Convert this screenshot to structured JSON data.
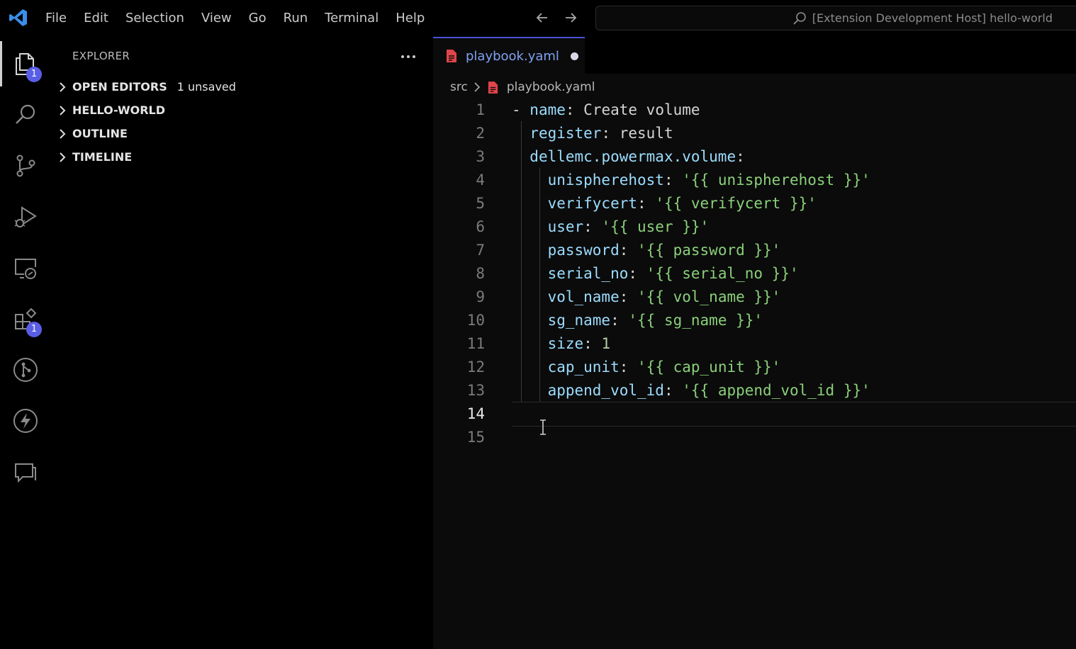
{
  "menu": [
    "File",
    "Edit",
    "Selection",
    "View",
    "Go",
    "Run",
    "Terminal",
    "Help"
  ],
  "command_center": "[Extension Development Host] hello-world",
  "activity_bar": {
    "explorer_badge": "1",
    "extensions_badge": "1"
  },
  "sidebar": {
    "title": "EXPLORER",
    "sections": [
      {
        "label": "OPEN EDITORS",
        "extra": "1 unsaved"
      },
      {
        "label": "HELLO-WORLD",
        "extra": ""
      },
      {
        "label": "OUTLINE",
        "extra": ""
      },
      {
        "label": "TIMELINE",
        "extra": ""
      }
    ]
  },
  "editor": {
    "tab": "playbook.yaml",
    "breadcrumb": {
      "folder": "src",
      "file": "playbook.yaml"
    },
    "lines": [
      {
        "n": "1",
        "indent": "",
        "dash": "- ",
        "key": "name",
        "sep": ": ",
        "val": "Create volume",
        "vtype": "p"
      },
      {
        "n": "2",
        "indent": "  ",
        "dash": "",
        "key": "register",
        "sep": ": ",
        "val": "result",
        "vtype": "p"
      },
      {
        "n": "3",
        "indent": "  ",
        "dash": "",
        "key": "dellemc.powermax.volume",
        "sep": ":",
        "val": "",
        "vtype": "p"
      },
      {
        "n": "4",
        "indent": "    ",
        "dash": "",
        "key": "unispherehost",
        "sep": ": ",
        "val": "'{{ unispherehost }}'",
        "vtype": "s"
      },
      {
        "n": "5",
        "indent": "    ",
        "dash": "",
        "key": "verifycert",
        "sep": ": ",
        "val": "'{{ verifycert }}'",
        "vtype": "s"
      },
      {
        "n": "6",
        "indent": "    ",
        "dash": "",
        "key": "user",
        "sep": ": ",
        "val": "'{{ user }}'",
        "vtype": "s"
      },
      {
        "n": "7",
        "indent": "    ",
        "dash": "",
        "key": "password",
        "sep": ": ",
        "val": "'{{ password }}'",
        "vtype": "s"
      },
      {
        "n": "8",
        "indent": "    ",
        "dash": "",
        "key": "serial_no",
        "sep": ": ",
        "val": "'{{ serial_no }}'",
        "vtype": "s"
      },
      {
        "n": "9",
        "indent": "    ",
        "dash": "",
        "key": "vol_name",
        "sep": ": ",
        "val": "'{{ vol_name }}'",
        "vtype": "s"
      },
      {
        "n": "10",
        "indent": "    ",
        "dash": "",
        "key": "sg_name",
        "sep": ": ",
        "val": "'{{ sg_name }}'",
        "vtype": "s"
      },
      {
        "n": "11",
        "indent": "    ",
        "dash": "",
        "key": "size",
        "sep": ": ",
        "val": "1",
        "vtype": "n"
      },
      {
        "n": "12",
        "indent": "    ",
        "dash": "",
        "key": "cap_unit",
        "sep": ": ",
        "val": "'{{ cap_unit }}'",
        "vtype": "s"
      },
      {
        "n": "13",
        "indent": "    ",
        "dash": "",
        "key": "append_vol_id",
        "sep": ": ",
        "val": "'{{ append_vol_id }}'",
        "vtype": "s"
      },
      {
        "n": "14",
        "indent": "",
        "dash": "",
        "key": "",
        "sep": "",
        "val": "",
        "vtype": "p"
      },
      {
        "n": "15",
        "indent": "",
        "dash": "",
        "key": "",
        "sep": "",
        "val": "",
        "vtype": "p"
      }
    ],
    "current_line": "14"
  },
  "colors": {
    "accent": "#5a5ee6",
    "key": "#9cdcfe",
    "string": "#8ad07a",
    "number": "#b5cea8",
    "file_icon": "#e0454b"
  }
}
